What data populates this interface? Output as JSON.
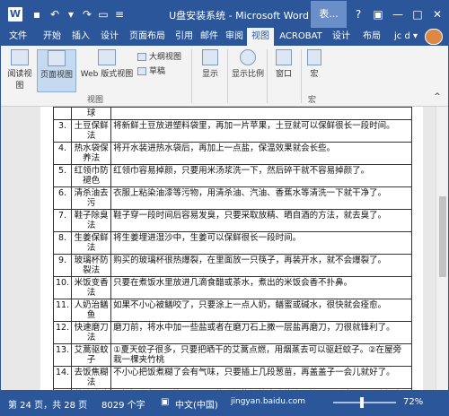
{
  "title": {
    "text": "U盘安装系统 - Microsoft Word",
    "contextual_tab": "表..."
  },
  "quick_access": [
    "save-icon",
    "undo-icon",
    "redo-icon",
    "print-icon"
  ],
  "window_controls": {
    "help": "?",
    "ribbon_display": "▣",
    "minimize": "—",
    "maximize": "□",
    "close": "✕"
  },
  "tabs": [
    "文件",
    "开始",
    "插入",
    "设计",
    "页面布局",
    "引用",
    "邮件",
    "审阅",
    "视图",
    "ACROBAT",
    "设计",
    "布局"
  ],
  "active_tab": "视图",
  "user": "jc d ▾",
  "ribbon": {
    "views": {
      "read_mode": "阅读视图",
      "print_layout": "页面视图",
      "web_layout": "Web 版式视图",
      "outline": "大纲视图",
      "draft": "草稿",
      "group_label": "视图"
    },
    "show": "显示",
    "zoom": "显示比例",
    "window": "窗口",
    "macros": "宏",
    "macros_group": "宏"
  },
  "table_rows": [
    {
      "num": "",
      "key": "球",
      "text": ""
    },
    {
      "num": "3.",
      "key": "土豆保鲜法",
      "text": "将新鲜土豆放进塑料袋里，再加一片苹果，土豆就可以保鲜很长一段时间。"
    },
    {
      "num": "4.",
      "key": "热水袋保养法",
      "text": "将开水装进热水袋后，再加上一点盐，保温效果就会长些。"
    },
    {
      "num": "5.",
      "key": "红领巾防褪色",
      "text": "红领巾容易掉颜，只要用米汤浆洗一下，然后碎干就不容易掉颜了。"
    },
    {
      "num": "6.",
      "key": "清杀油去污",
      "text": "衣服上粘染油漆等污物，用清杀油、汽油、香蕉水等清洗一下就干净了。"
    },
    {
      "num": "7.",
      "key": "鞋子除臭法",
      "text": "鞋子穿一段时间后容易发臭，只要采取放精、晒自酒的方法，就去臭了。"
    },
    {
      "num": "8.",
      "key": "生姜保鲜法",
      "text": "将生姜埋进湿沙中，生姜可以保鲜很长一段时间。"
    },
    {
      "num": "9.",
      "key": "玻璃杯防裂法",
      "text": "购买的玻璃杯很热爆裂，在里面放一只筷子，再装开水，就不会爆裂了。"
    },
    {
      "num": "10.",
      "key": "米饭变香法",
      "text": "只要在煮饭水里放进几滴食醋或茶水，煮出的米饭会香不扑鼻。"
    },
    {
      "num": "11.",
      "key": "人奶治鳝鱼",
      "text": "如果不小心被鳝咬了，只要涂上一点人奶，鳝蜜或碱水，很快就会痊愈。"
    },
    {
      "num": "12.",
      "key": "快速磨刀法",
      "text": "磨刀前，将水中加一些盐或者在磨刀石上撒一层盐再磨刀，刀很就锋利了。"
    },
    {
      "num": "13.",
      "key": "艾蒿驱蚊子",
      "text": "①夏天蚊子很多，只要把晒干的艾蒿点燃，用烟蒸去可以驱赶蚊子。②在屋旁栽一棵夹竹桃"
    },
    {
      "num": "14.",
      "key": "去饭焦糊法",
      "text": "不小心把饭煮糊了会有气味，只要插上几段葱苗，再盖盖子一会儿就好了。"
    },
    {
      "num": "15.",
      "key": "茶渍清除法",
      "text": "①年轻人容易刷黄，只要用茶叶加盐刷就清除茶渍，就可以刷洗了。②聊气病可用茄子根加盐水，土霉素治痔，香花水相燃，就可以等方法。"
    }
  ],
  "status_bar": {
    "page": "第 24 页，共 28 页",
    "words": "8029 个字",
    "language": "中文(中国)",
    "zoom": "72%",
    "watermark": "jingyan.baidu.com"
  }
}
